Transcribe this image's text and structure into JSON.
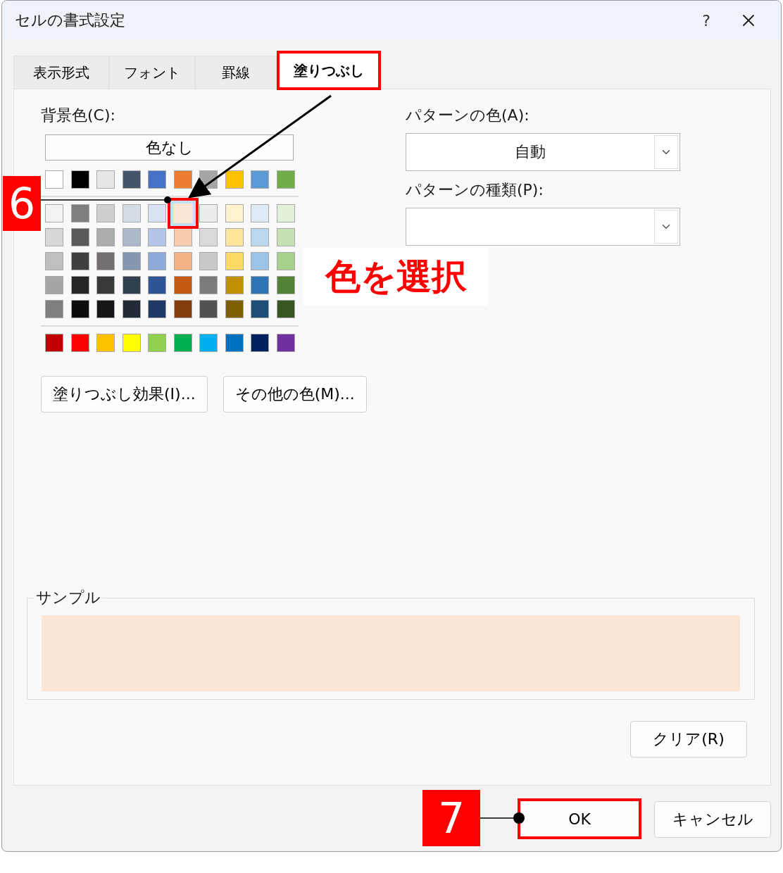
{
  "window": {
    "title": "セルの書式設定",
    "help_button": "?"
  },
  "tabs": [
    {
      "label": "表示形式",
      "selected": false,
      "highlighted": false
    },
    {
      "label": "フォント",
      "selected": false,
      "highlighted": false
    },
    {
      "label": "罫線",
      "selected": false,
      "highlighted": false
    },
    {
      "label": "塗りつぶし",
      "selected": true,
      "highlighted": true
    }
  ],
  "background_color": {
    "label": "背景色(C):",
    "no_color_button": "色なし",
    "theme_row": [
      {
        "color": "#ffffff",
        "selected": false
      },
      {
        "color": "#000000",
        "selected": false
      },
      {
        "color": "#e7e6e6",
        "selected": false
      },
      {
        "color": "#44546a",
        "selected": false
      },
      {
        "color": "#4472c4",
        "selected": false
      },
      {
        "color": "#ed7d31",
        "selected": false
      },
      {
        "color": "#a5a5a5",
        "selected": false
      },
      {
        "color": "#ffc000",
        "selected": false
      },
      {
        "color": "#5b9bd5",
        "selected": false
      },
      {
        "color": "#70ad47",
        "selected": false
      }
    ],
    "tint_rows": [
      {
        "swatches": [
          {
            "color": "#f2f2f2",
            "selected": false
          },
          {
            "color": "#7f7f7f",
            "selected": false
          },
          {
            "color": "#d0cece",
            "selected": false
          },
          {
            "color": "#d6dce4",
            "selected": false
          },
          {
            "color": "#d9e2f3",
            "selected": false
          },
          {
            "color": "#fbe5d5",
            "selected": true,
            "highlighted": true
          },
          {
            "color": "#ededed",
            "selected": false
          },
          {
            "color": "#fff2cc",
            "selected": false
          },
          {
            "color": "#deebf6",
            "selected": false
          },
          {
            "color": "#e2efd9",
            "selected": false
          }
        ]
      },
      {
        "swatches": [
          {
            "color": "#d8d8d8",
            "selected": false
          },
          {
            "color": "#595959",
            "selected": false
          },
          {
            "color": "#aeabab",
            "selected": false
          },
          {
            "color": "#adb9ca",
            "selected": false
          },
          {
            "color": "#b4c6e7",
            "selected": false
          },
          {
            "color": "#f7cbac",
            "selected": false
          },
          {
            "color": "#dbdbdb",
            "selected": false
          },
          {
            "color": "#fee599",
            "selected": false
          },
          {
            "color": "#bdd7ee",
            "selected": false
          },
          {
            "color": "#c5e0b3",
            "selected": false
          }
        ]
      },
      {
        "swatches": [
          {
            "color": "#bfbfbf",
            "selected": false
          },
          {
            "color": "#3f3f3f",
            "selected": false
          },
          {
            "color": "#757070",
            "selected": false
          },
          {
            "color": "#8496b0",
            "selected": false
          },
          {
            "color": "#8eaadb",
            "selected": false
          },
          {
            "color": "#f4b183",
            "selected": false
          },
          {
            "color": "#c9c9c9",
            "selected": false
          },
          {
            "color": "#ffd965",
            "selected": false
          },
          {
            "color": "#9cc3e5",
            "selected": false
          },
          {
            "color": "#a8d08d",
            "selected": false
          }
        ]
      },
      {
        "swatches": [
          {
            "color": "#a5a5a5",
            "selected": false
          },
          {
            "color": "#262626",
            "selected": false
          },
          {
            "color": "#3a3838",
            "selected": false
          },
          {
            "color": "#323f4f",
            "selected": false
          },
          {
            "color": "#2f5496",
            "selected": false
          },
          {
            "color": "#c55a11",
            "selected": false
          },
          {
            "color": "#7b7b7b",
            "selected": false
          },
          {
            "color": "#bf9000",
            "selected": false
          },
          {
            "color": "#2e75b5",
            "selected": false
          },
          {
            "color": "#538135",
            "selected": false
          }
        ]
      },
      {
        "swatches": [
          {
            "color": "#7f7f7f",
            "selected": false
          },
          {
            "color": "#0c0c0c",
            "selected": false
          },
          {
            "color": "#171616",
            "selected": false
          },
          {
            "color": "#222a35",
            "selected": false
          },
          {
            "color": "#1f3864",
            "selected": false
          },
          {
            "color": "#833c0b",
            "selected": false
          },
          {
            "color": "#525252",
            "selected": false
          },
          {
            "color": "#7f6000",
            "selected": false
          },
          {
            "color": "#1e4e79",
            "selected": false
          },
          {
            "color": "#375623",
            "selected": false
          }
        ]
      }
    ],
    "standard_row": [
      {
        "color": "#c00000",
        "selected": false
      },
      {
        "color": "#ff0000",
        "selected": false
      },
      {
        "color": "#ffc000",
        "selected": false
      },
      {
        "color": "#ffff00",
        "selected": false
      },
      {
        "color": "#92d050",
        "selected": false
      },
      {
        "color": "#00b050",
        "selected": false
      },
      {
        "color": "#00b0f0",
        "selected": false
      },
      {
        "color": "#0070c0",
        "selected": false
      },
      {
        "color": "#002060",
        "selected": false
      },
      {
        "color": "#7030a0",
        "selected": false
      }
    ],
    "fill_effects_button": "塗りつぶし効果(I)...",
    "more_colors_button": "その他の色(M)..."
  },
  "pattern": {
    "color_label": "パターンの色(A):",
    "color_value": "自動",
    "style_label": "パターンの種類(P):"
  },
  "sample": {
    "label": "サンプル"
  },
  "clear_button": "クリア(R)",
  "buttons": [
    {
      "label": "OK",
      "highlighted": true
    },
    {
      "label": "キャンセル",
      "highlighted": false
    }
  ],
  "annotations": {
    "step_badges": [
      "6",
      "7"
    ],
    "callout": "色を選択"
  }
}
